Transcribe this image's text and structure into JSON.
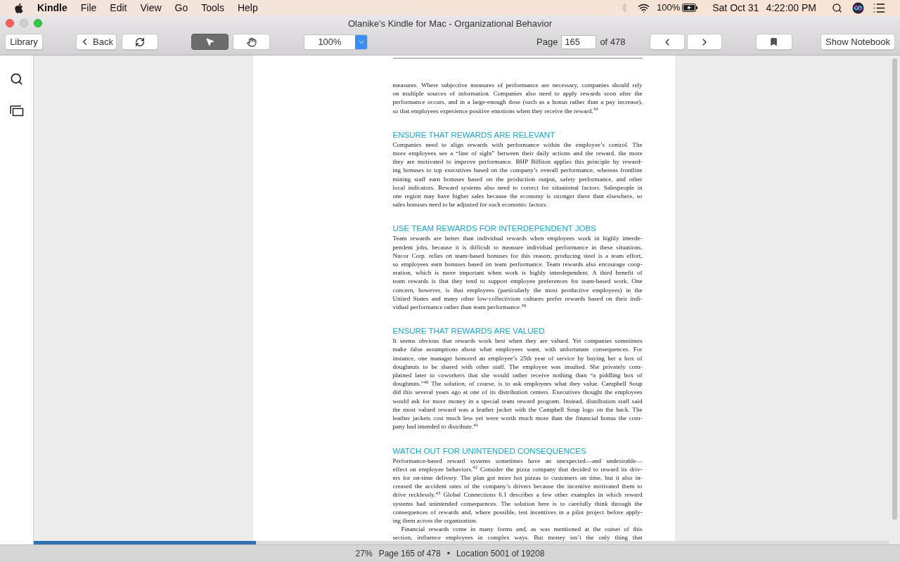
{
  "menu_bar": {
    "app": "Kindle",
    "items": [
      "File",
      "Edit",
      "View",
      "Go",
      "Tools",
      "Help"
    ],
    "battery": "100%",
    "date": "Sat Oct 31",
    "time": "4:22:00 PM"
  },
  "window": {
    "title": "Olanike's Kindle for Mac - Organizational Behavior"
  },
  "toolbar": {
    "library": "Library",
    "back": "Back",
    "tools": [
      {
        "kind": "pointer",
        "selected": true
      },
      {
        "kind": "hand",
        "selected": false
      }
    ],
    "zoom": "100%",
    "page_label": "Page",
    "page": "165",
    "page_total": "of 478",
    "notebook": "Show Notebook"
  },
  "sections": [
    {
      "paragraphs": [
        {
          "indented": false,
          "continues": false,
          "lines": [
            "measures. Where subjective measures of performance are necessary, companies should rely",
            "on multiple sources of information. Companies also need to apply rewards soon after the",
            "performance occurs, and in a large-enough dose (such as a bonus rather than a pay increase),",
            "so that employees experience positive emotions when they receive the reward.$^{34}$"
          ]
        }
      ]
    },
    {
      "heading": "ENSURE THAT REWARDS ARE RELEVANT",
      "paragraphs": [
        {
          "indented": false,
          "continues": false,
          "lines": [
            "Companies need to align rewards with performance within the employee’s control. The",
            "more employees see a “line of sight” between their daily actions and the reward, the more",
            "they are motivated to improve performance. BHP Billiton applies this principle by reward-",
            "ing bonuses to top executives based on the company’s overall performance, whereas frontline",
            "mining staff earn bonuses based on the production output, safety performance, and other",
            "local indicators. Reward systems also need to correct for situational factors. Salespeople in",
            "one region may have higher sales because the economy is stronger there than elsewhere, so",
            "sales bonuses need to be adjusted for such economic factors."
          ]
        }
      ]
    },
    {
      "heading": "USE TEAM REWARDS FOR INTERDEPENDENT JOBS",
      "paragraphs": [
        {
          "indented": false,
          "continues": false,
          "lines": [
            "Team rewards are better than individual rewards when employees work in highly interde-",
            "pendent jobs, because it is difficult to measure individual performance in these situations.",
            "Nucor Corp. relies on team-based bonuses for this reason; producing steel is a team effort,",
            "so employees earn bonuses based on team performance. Team rewards also encourage coop-",
            "eration, which is more important when work is highly interdependent. A third benefit of",
            "team rewards is that they tend to support employee preferences for team-based work. One",
            "concern, however, is that employees (particularly the most productive employees) in the",
            "United States and many other low-collectivism cultures prefer rewards based on their indi-",
            "vidual performance rather than team performance.$^{39}$"
          ]
        }
      ]
    },
    {
      "heading": "ENSURE THAT REWARDS ARE VALUED",
      "paragraphs": [
        {
          "indented": false,
          "continues": false,
          "lines": [
            "It seems obvious that rewards work best when they are valued. Yet companies sometimes",
            "make false assumptions about what employees want, with unfortunate consequences. For",
            "instance, one manager honored an employee’s 25th year of service by buying her a box of",
            "doughnuts to be shared with other staff. The employee was insulted. She privately com-",
            "plained later to coworkers that she would rather receive nothing than “a piddling box of",
            "doughnuts.”$^{40}$ The solution, of course, is to ask employees what they value. Campbell Soup",
            "did this several years ago at one of its distribution centers. Executives thought the employees",
            "would ask for more money in a special team reward program. Instead, distribution staff said",
            "the most valued reward was a leather jacket with the Campbell Soup logo on the back. The",
            "leather jackets cost much less yet were worth much more than the financial bonus the com-",
            "pany had intended to distribute.$^{41}$"
          ]
        }
      ]
    },
    {
      "heading": "WATCH OUT FOR UNINTENDED CONSEQUENCES",
      "paragraphs": [
        {
          "indented": false,
          "continues": false,
          "lines": [
            "Performance-based reward systems sometimes have an unexpected—and undesirable—",
            "effect on employee behaviors.$^{42}$ Consider the pizza company that decided to reward its driv-",
            "ers for on-time delivery. The plan got more hot pizzas to customers on time, but it also in-",
            "creased the accident rates of the company’s drivers because the incentive motivated them to",
            "drive recklessly.$^{43}$ Global Connections 6.1 describes a few other examples in which reward",
            "systems had unintended consequences. The solution here is to carefully think through the",
            "consequences of rewards and, where possible, test incentives in a pilot project before apply-",
            "ing them across the organization."
          ]
        },
        {
          "indented": true,
          "continues": true,
          "lines": [
            "Financial rewards come in many forms and, as was mentioned at the outset of this",
            "section, influence employees in complex ways. But money isn’t the only thing that"
          ]
        }
      ]
    }
  ],
  "progress": {
    "level": 0.26
  },
  "status_bar": {
    "percent": "27%",
    "page": "Page 165 of 478",
    "separator": "•",
    "location": "Location 5001 of 19208"
  }
}
